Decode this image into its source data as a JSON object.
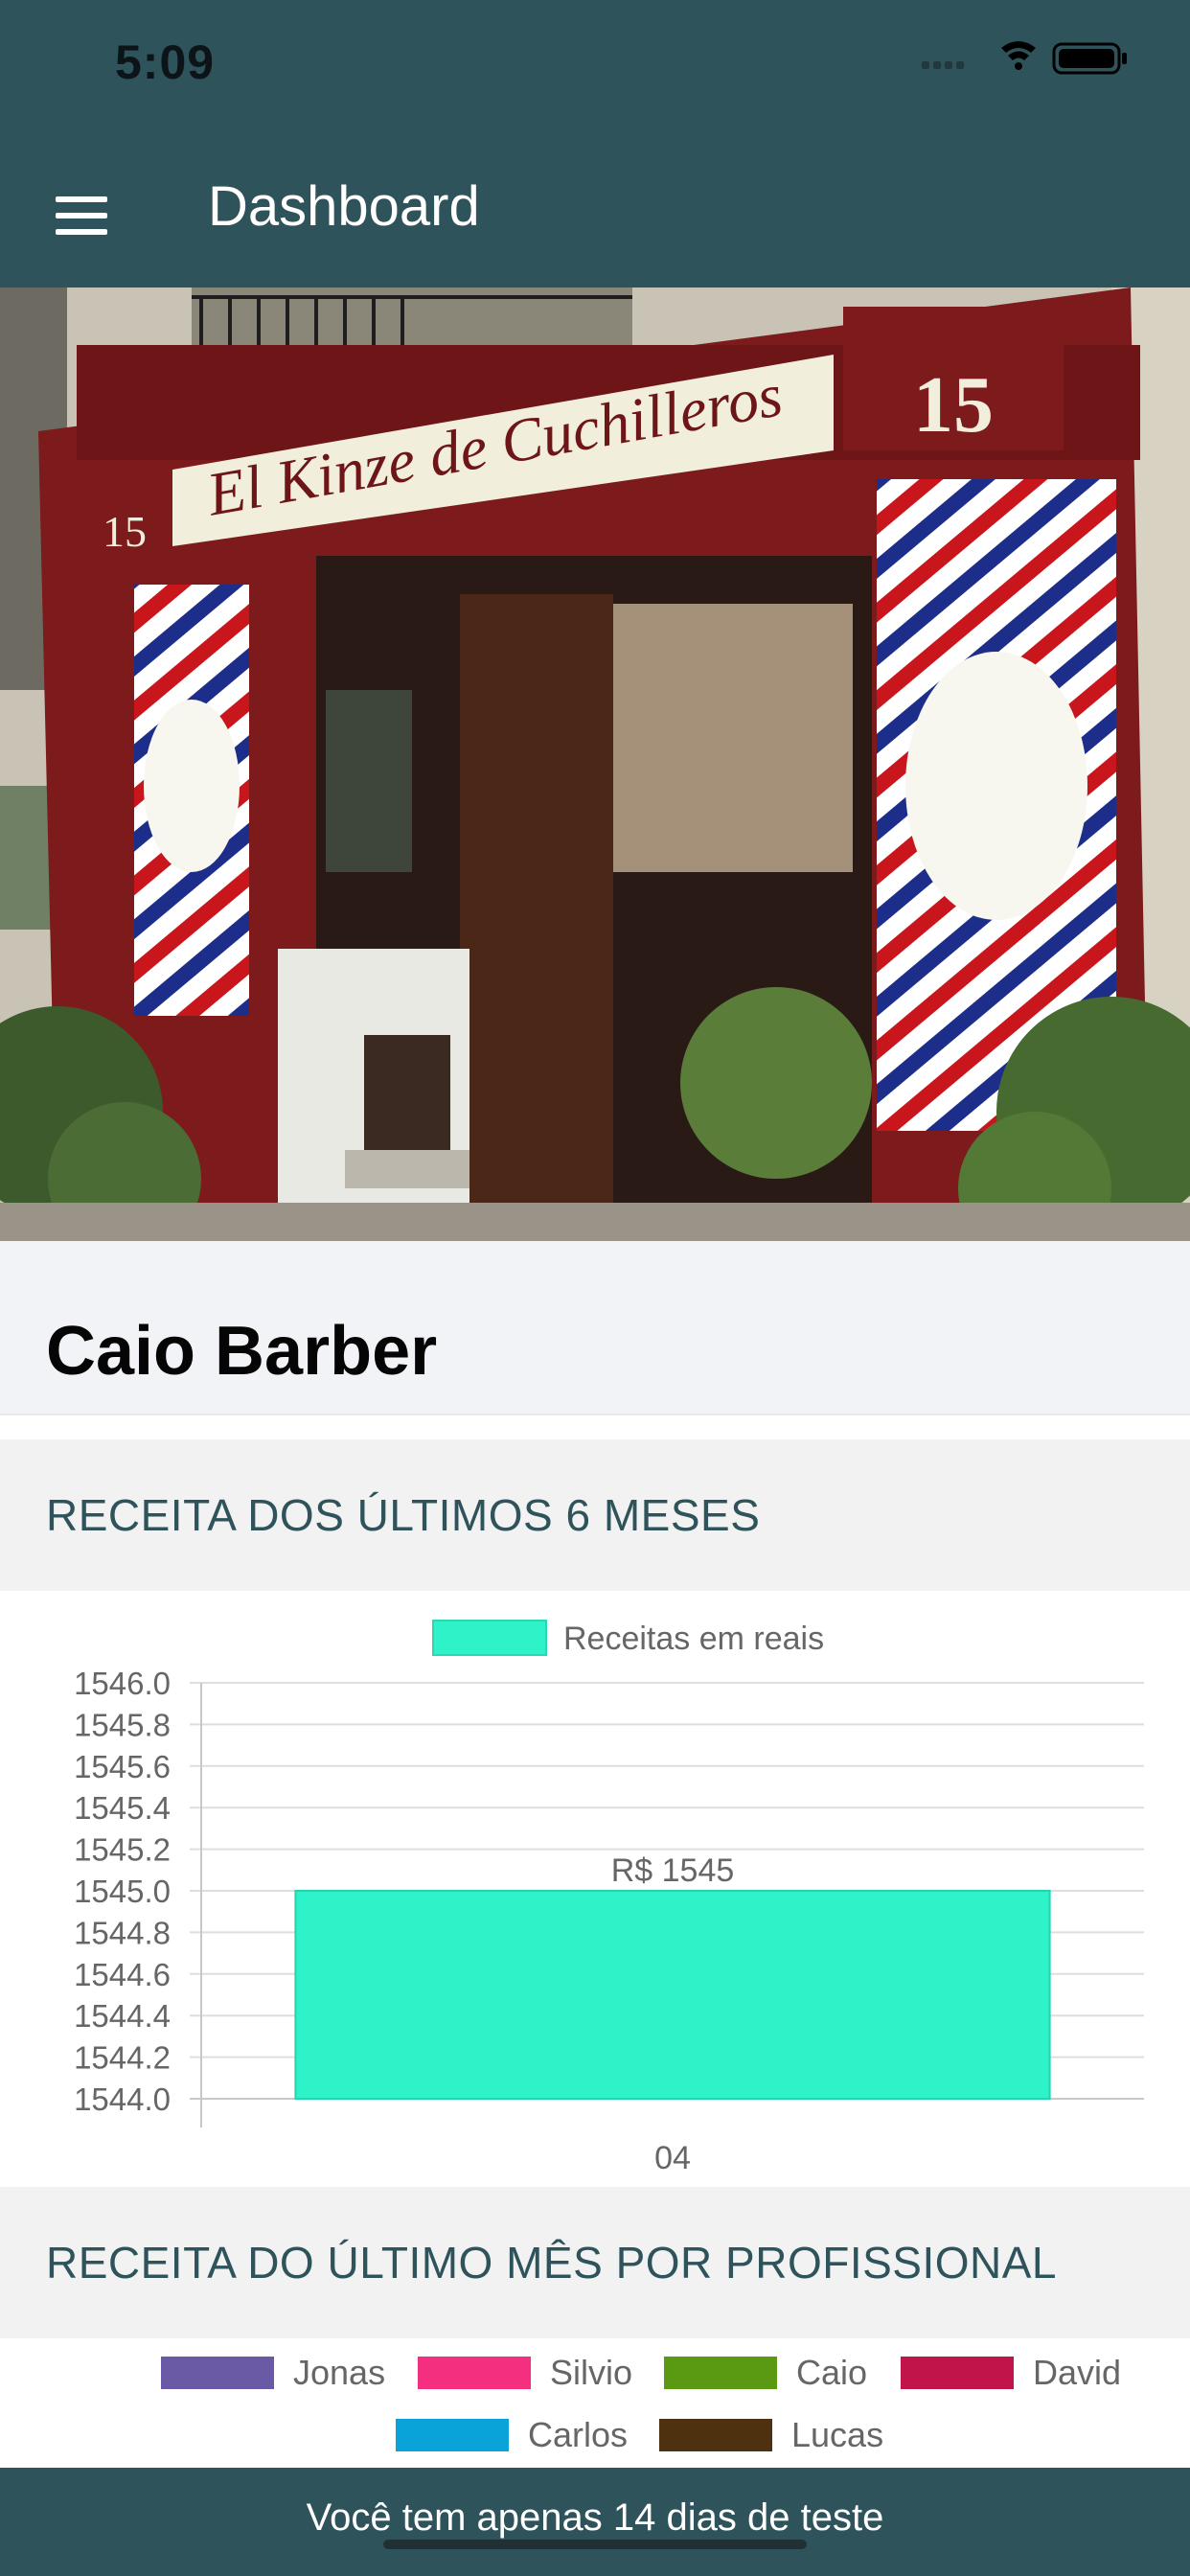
{
  "status_bar": {
    "time": "5:09"
  },
  "app_bar": {
    "title": "Dashboard"
  },
  "shop": {
    "name": "Caio Barber"
  },
  "section_revenue": {
    "title": "RECEITA DOS ÚLTIMOS 6 MESES"
  },
  "section_professional": {
    "title": "RECEITA DO ÚLTIMO MÊS POR PROFISSIONAL"
  },
  "chart_data": {
    "type": "bar",
    "categories": [
      "04"
    ],
    "series": [
      {
        "name": "Receitas em reais",
        "values": [
          1545
        ],
        "color": "#2ef2c8"
      }
    ],
    "data_labels": [
      "R$ 1545"
    ],
    "ylim": [
      1544.0,
      1546.0
    ],
    "yticks": [
      "1546.0",
      "1545.8",
      "1545.6",
      "1545.4",
      "1545.2",
      "1545.0",
      "1544.8",
      "1544.6",
      "1544.4",
      "1544.2",
      "1544.0"
    ],
    "grid": true,
    "legend": "top-center"
  },
  "professional_legend": [
    {
      "name": "Jonas",
      "color": "#6a5aa6"
    },
    {
      "name": "Silvio",
      "color": "#f42f80"
    },
    {
      "name": "Caio",
      "color": "#5a9a13"
    },
    {
      "name": "David",
      "color": "#c0144a"
    },
    {
      "name": "Carlos",
      "color": "#0aa3d9"
    },
    {
      "name": "Lucas",
      "color": "#4e3210"
    }
  ],
  "trial_banner": {
    "text": "Você tem apenas 14 dias de teste"
  }
}
